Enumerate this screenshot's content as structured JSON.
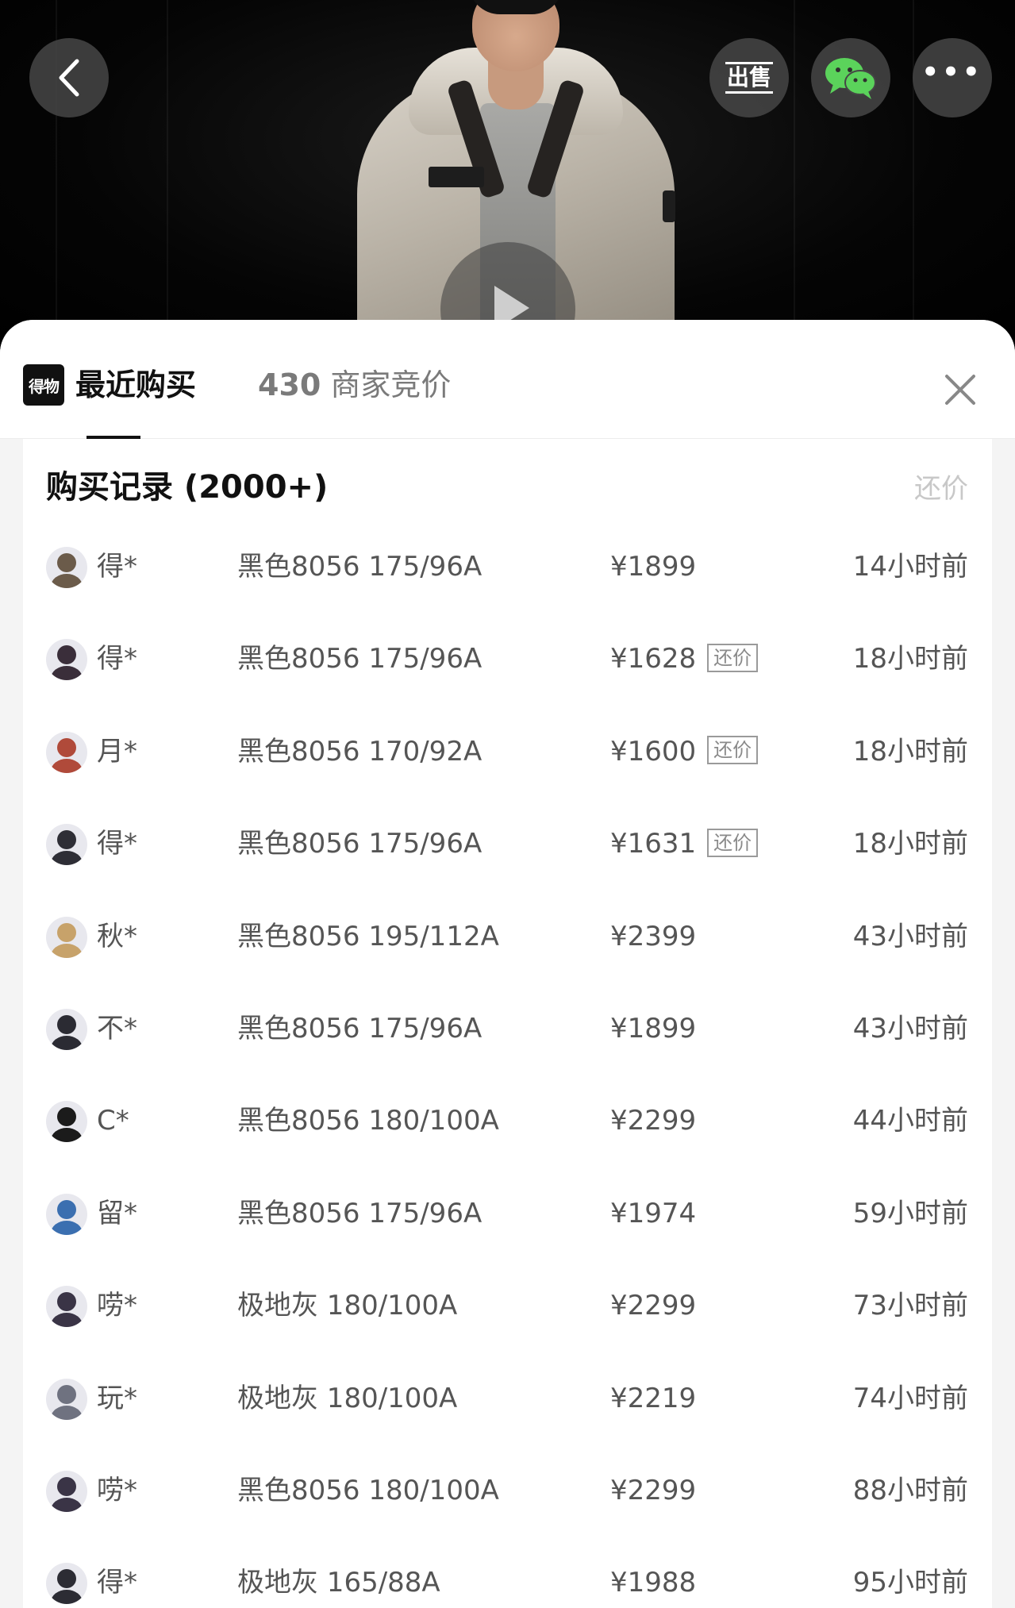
{
  "header": {
    "sell_button_label": "出售",
    "wechat_icon": "wechat-icon",
    "more_icon": "more-icon",
    "back_icon": "back-arrow-icon"
  },
  "tabs": {
    "brand_logo": "得物",
    "recent": "最近购买",
    "bids_count": "430",
    "bids_label": "商家竞价"
  },
  "record_section": {
    "title": "购买记录 (2000+)",
    "counter_label": "还价",
    "counter_tag": "还价"
  },
  "records": [
    {
      "user": "得*",
      "variant": "黑色8056 175/96A",
      "price": "¥1899",
      "counter": false,
      "time": "14小时前",
      "avatar_color": "#6b5b4a"
    },
    {
      "user": "得*",
      "variant": "黑色8056 175/96A",
      "price": "¥1628",
      "counter": true,
      "time": "18小时前",
      "avatar_color": "#3a2e3a"
    },
    {
      "user": "月*",
      "variant": "黑色8056 170/92A",
      "price": "¥1600",
      "counter": true,
      "time": "18小时前",
      "avatar_color": "#b04a3a"
    },
    {
      "user": "得*",
      "variant": "黑色8056 175/96A",
      "price": "¥1631",
      "counter": true,
      "time": "18小时前",
      "avatar_color": "#2e2e36"
    },
    {
      "user": "秋*",
      "variant": "黑色8056 195/112A",
      "price": "¥2399",
      "counter": false,
      "time": "43小时前",
      "avatar_color": "#c7a26a"
    },
    {
      "user": "不*",
      "variant": "黑色8056 175/96A",
      "price": "¥1899",
      "counter": false,
      "time": "43小时前",
      "avatar_color": "#2b2b33"
    },
    {
      "user": "C*",
      "variant": "黑色8056 180/100A",
      "price": "¥2299",
      "counter": false,
      "time": "44小时前",
      "avatar_color": "#1b1b1b"
    },
    {
      "user": "留*",
      "variant": "黑色8056 175/96A",
      "price": "¥1974",
      "counter": false,
      "time": "59小时前",
      "avatar_color": "#3b6fb0"
    },
    {
      "user": "唠*",
      "variant": "极地灰 180/100A",
      "price": "¥2299",
      "counter": false,
      "time": "73小时前",
      "avatar_color": "#3a3446"
    },
    {
      "user": "玩*",
      "variant": "极地灰 180/100A",
      "price": "¥2219",
      "counter": false,
      "time": "74小时前",
      "avatar_color": "#6f7280"
    },
    {
      "user": "唠*",
      "variant": "黑色8056 180/100A",
      "price": "¥2299",
      "counter": false,
      "time": "88小时前",
      "avatar_color": "#3a3446"
    },
    {
      "user": "得*",
      "variant": "极地灰 165/88A",
      "price": "¥1988",
      "counter": false,
      "time": "95小时前",
      "avatar_color": "#2c2c34"
    }
  ]
}
